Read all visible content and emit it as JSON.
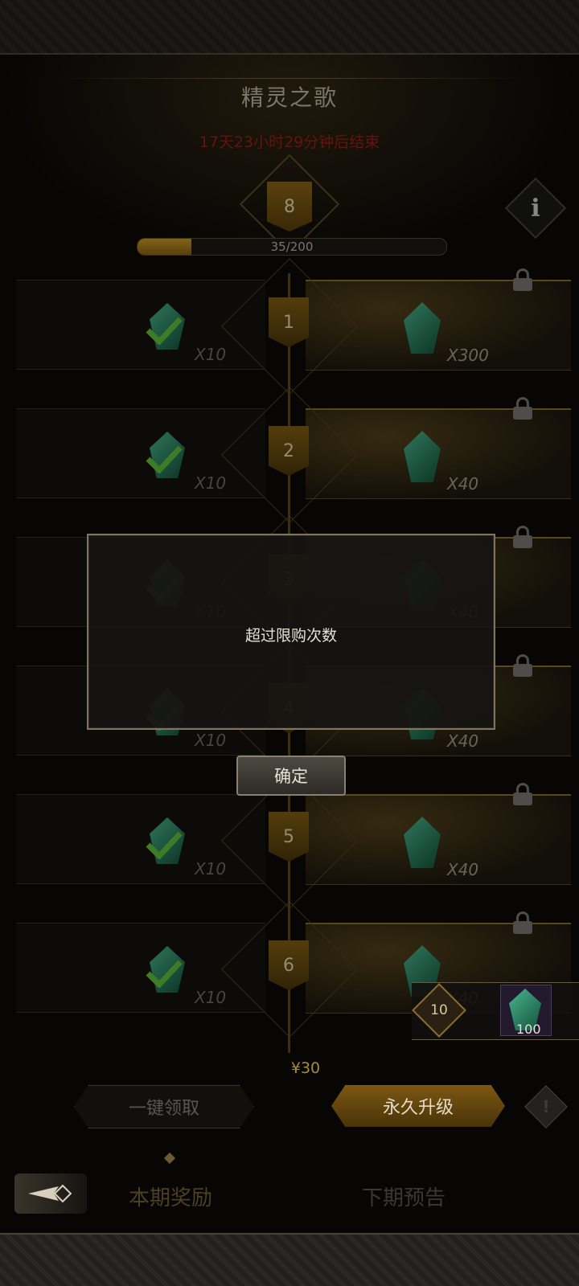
{
  "header": {
    "title": "精灵之歌",
    "countdown": "17天23小时29分钟后结束",
    "level": "8",
    "info_icon": "info-icon",
    "progress": {
      "text": "35/200",
      "value": 35,
      "max": 200
    }
  },
  "rewards": [
    {
      "level": "1",
      "free_qty": "X10",
      "premium_qty": "X300",
      "claimed": true
    },
    {
      "level": "2",
      "free_qty": "X10",
      "premium_qty": "X40",
      "claimed": true
    },
    {
      "level": "3",
      "free_qty": "X10",
      "premium_qty": "X40",
      "claimed": true
    },
    {
      "level": "4",
      "free_qty": "X10",
      "premium_qty": "X40",
      "claimed": true
    },
    {
      "level": "5",
      "free_qty": "X10",
      "premium_qty": "X40",
      "claimed": true
    },
    {
      "level": "6",
      "free_qty": "X10",
      "premium_qty": "X40",
      "claimed": true
    }
  ],
  "dialog": {
    "message": "超过限购次数",
    "confirm_label": "确定"
  },
  "bundle": {
    "level": "10",
    "count": "100"
  },
  "actions": {
    "price": "¥30",
    "claim_all_label": "一键领取",
    "upgrade_label": "永久升级"
  },
  "tabs": {
    "current": "本期奖励",
    "next": "下期预告"
  },
  "colors": {
    "accent_gold": "#8a6516",
    "countdown_red": "#9a1e14",
    "gem_green": "#4bb58d"
  }
}
